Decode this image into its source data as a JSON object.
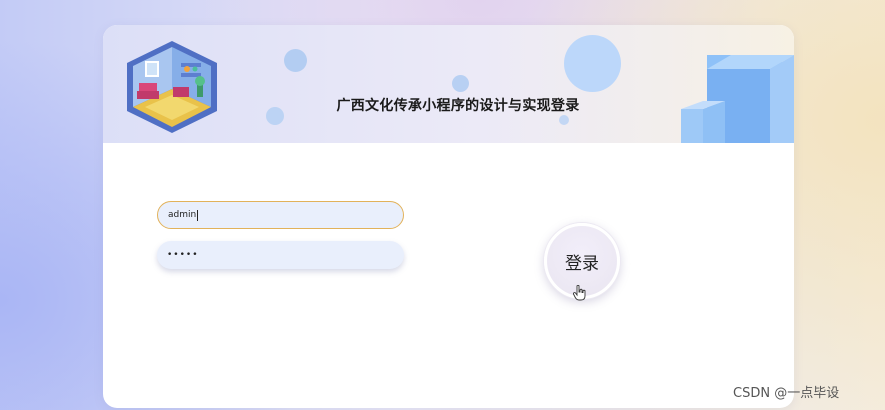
{
  "header": {
    "title": "广西文化传承小程序的设计与实现登录"
  },
  "login_form": {
    "username_value": "admin",
    "password_value": "•••••",
    "login_button_label": "登录"
  },
  "decorations": {
    "room_illustration": "isometric-room-illustration",
    "cubes_icon": "blue-cubes-icon",
    "cursor_icon": "hand-pointer-icon"
  },
  "colors": {
    "input_focus_border": "#e2b25a",
    "input_background": "#e9effc",
    "cube_blue": "#7fb6f6"
  },
  "watermark": {
    "text": "CSDN @一点毕设"
  }
}
